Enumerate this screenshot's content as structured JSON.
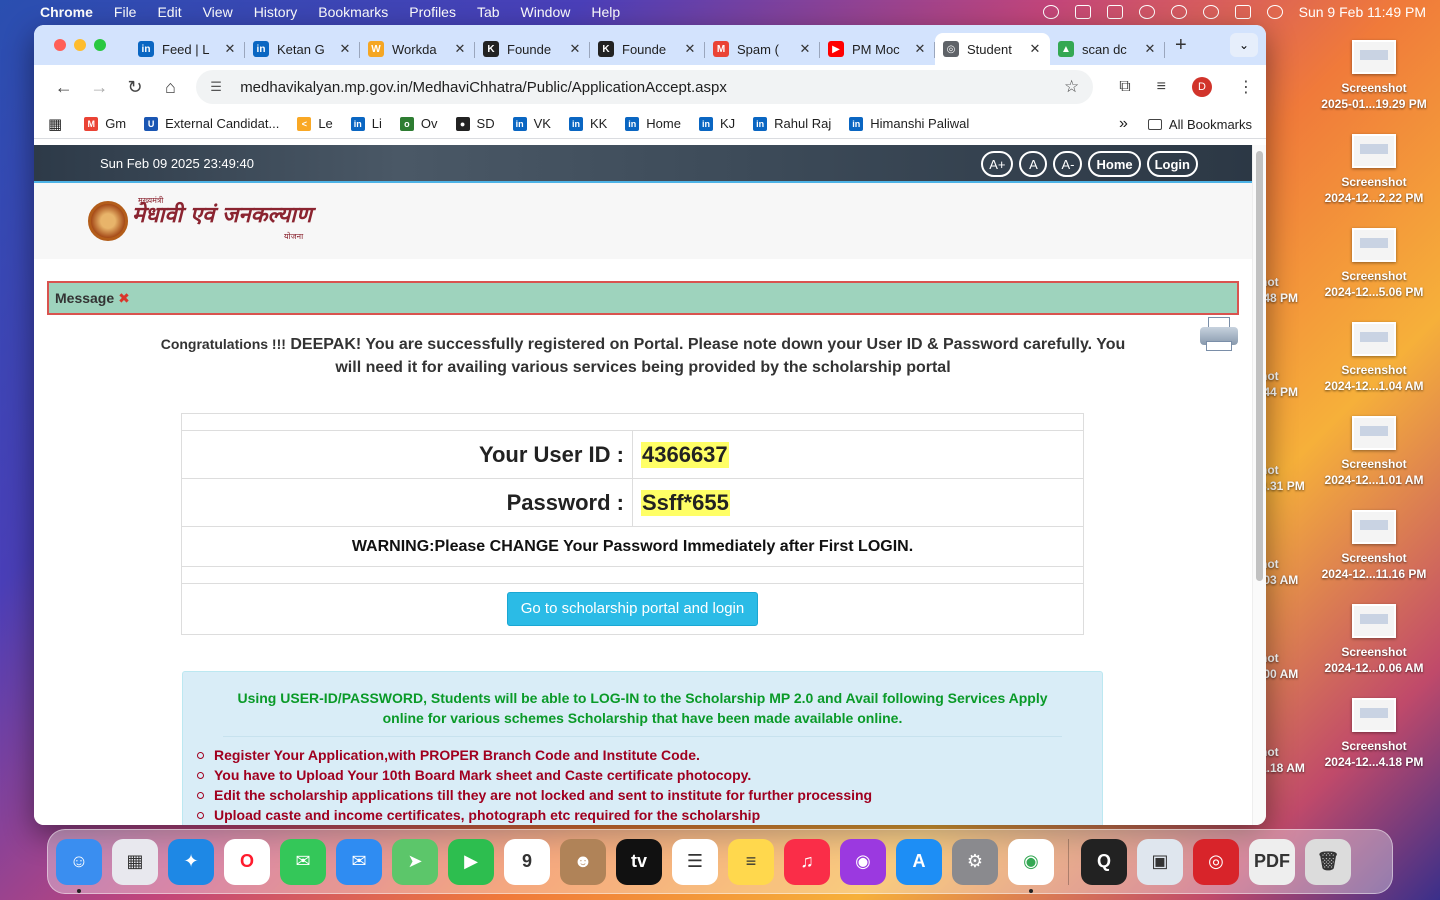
{
  "menubar": {
    "app": "Chrome",
    "items": [
      "File",
      "Edit",
      "View",
      "History",
      "Bookmarks",
      "Profiles",
      "Tab",
      "Window",
      "Help"
    ],
    "datetime": "Sun 9 Feb  11:49 PM"
  },
  "desktop": {
    "icons": [
      {
        "name": "Screenshot",
        "sub": "2025-01...19.29 PM"
      },
      {
        "name": "Screenshot",
        "sub": "2024-12...2.22 PM"
      },
      {
        "name": "Screenshot",
        "sub": "2024-12...5.06 PM"
      },
      {
        "name": "Screenshot",
        "sub": "2024-12...1.04 AM"
      },
      {
        "name": "Screenshot",
        "sub": "2024-12...1.01 AM"
      },
      {
        "name": "Screenshot",
        "sub": "2024-12...11.16 PM"
      },
      {
        "name": "Screenshot",
        "sub": "2024-12...0.06 AM"
      },
      {
        "name": "Screenshot",
        "sub": "2024-12...4.18 PM"
      }
    ],
    "ghosts": [
      "hot",
      ".48 PM",
      "hot",
      ".44 PM",
      "hot",
      "3.31 PM",
      "hot",
      ".03 AM",
      "hot",
      ".00 AM",
      "hot",
      "1.18 AM"
    ]
  },
  "browser": {
    "tabs": [
      {
        "title": "Feed | L",
        "color": "#0a66c2",
        "glyph": "in"
      },
      {
        "title": "Ketan G",
        "color": "#0a66c2",
        "glyph": "in"
      },
      {
        "title": "Workda",
        "color": "#f5a623",
        "glyph": "W"
      },
      {
        "title": "Founde",
        "color": "#222222",
        "glyph": "K"
      },
      {
        "title": "Founde",
        "color": "#222222",
        "glyph": "K"
      },
      {
        "title": "Spam (",
        "color": "#ea4335",
        "glyph": "M"
      },
      {
        "title": "PM Moc",
        "color": "#ff0000",
        "glyph": "▶"
      },
      {
        "title": "Student",
        "color": "#5f6368",
        "glyph": "◎"
      },
      {
        "title": "scan dc",
        "color": "#34a853",
        "glyph": "▲"
      }
    ],
    "url": "medhavikalyan.mp.gov.in/MedhaviChhatra/Public/ApplicationAccept.aspx",
    "profile_initial": "D",
    "bookmarks": [
      {
        "label": "Gm",
        "color": "#ea4335",
        "glyph": "M"
      },
      {
        "label": "External Candidat...",
        "color": "#1a56b3",
        "glyph": "U"
      },
      {
        "label": "Le",
        "color": "#f9a825",
        "glyph": "<"
      },
      {
        "label": "Li",
        "color": "#0a66c2",
        "glyph": "in"
      },
      {
        "label": "Ov",
        "color": "#2e7d32",
        "glyph": "o"
      },
      {
        "label": "SD",
        "color": "#222222",
        "glyph": "●"
      },
      {
        "label": "VK",
        "color": "#0a66c2",
        "glyph": "in"
      },
      {
        "label": "KK",
        "color": "#0a66c2",
        "glyph": "in"
      },
      {
        "label": "Home",
        "color": "#0a66c2",
        "glyph": "in"
      },
      {
        "label": "KJ",
        "color": "#0a66c2",
        "glyph": "in"
      },
      {
        "label": "Rahul Raj",
        "color": "#0a66c2",
        "glyph": "in"
      },
      {
        "label": "Himanshi Paliwal",
        "color": "#0a66c2",
        "glyph": "in"
      }
    ],
    "all_bookmarks": "All Bookmarks"
  },
  "site": {
    "datetime": "Sun Feb 09 2025 23:49:40",
    "font_buttons": [
      "A+",
      "A",
      "A-"
    ],
    "home": "Home",
    "login": "Login",
    "logo_small": "मुख्यमंत्री",
    "logo_text": "मेधावी एवं जनकल्याण",
    "logo_tag": "योजना"
  },
  "message": {
    "label": "Message",
    "congrats_lead": "Congratulations !!!",
    "congrats_body": "DEEPAK! You are successfully registered on Portal. Please note down your User ID & Password carefully. You will need it for availing various services being provided by the scholarship portal"
  },
  "credentials": {
    "user_id_label": "Your User ID :",
    "user_id": "4366637",
    "password_label": "Password :",
    "password": "Ssff*655",
    "warning": "WARNING:Please CHANGE Your Password Immediately after First LOGIN.",
    "button": "Go to scholarship portal and login"
  },
  "info": {
    "heading": "Using USER-ID/PASSWORD, Students will be able to LOG-IN to the Scholarship MP 2.0 and Avail following Services Apply online for various schemes Scholarship that have been made available online.",
    "items": [
      "Register Your Application,with PROPER Branch Code and Institute Code.",
      "You have to Upload Your 10th Board Mark sheet and Caste certificate photocopy.",
      "Edit the scholarship applications till they are not locked and sent to institute for further processing",
      "Upload caste and income certificates, photograph etc required for the scholarship"
    ]
  },
  "dock": {
    "apps": [
      {
        "name": "finder",
        "color": "#3a8ef0",
        "glyph": "☺",
        "dot": true
      },
      {
        "name": "launchpad",
        "color": "#e8e8ee",
        "glyph": "▦",
        "dot": false
      },
      {
        "name": "safari",
        "color": "#1e88e5",
        "glyph": "✦",
        "dot": false
      },
      {
        "name": "opera",
        "color": "#ffffff",
        "glyph": "O",
        "dot": false
      },
      {
        "name": "messages",
        "color": "#34c759",
        "glyph": "✉",
        "dot": false
      },
      {
        "name": "mail",
        "color": "#2f8cf2",
        "glyph": "✉",
        "dot": false
      },
      {
        "name": "maps",
        "color": "#5cc66a",
        "glyph": "➤",
        "dot": false
      },
      {
        "name": "facetime",
        "color": "#2dbe4f",
        "glyph": "▶",
        "dot": false
      },
      {
        "name": "calendar",
        "color": "#ffffff",
        "glyph": "9",
        "dot": false
      },
      {
        "name": "contacts",
        "color": "#b08358",
        "glyph": "☻",
        "dot": false
      },
      {
        "name": "tv",
        "color": "#111111",
        "glyph": "tv",
        "dot": false
      },
      {
        "name": "reminders",
        "color": "#ffffff",
        "glyph": "☰",
        "dot": false
      },
      {
        "name": "notes",
        "color": "#ffd84d",
        "glyph": "≡",
        "dot": false
      },
      {
        "name": "music",
        "color": "#fa2d48",
        "glyph": "♫",
        "dot": false
      },
      {
        "name": "podcasts",
        "color": "#9b39e0",
        "glyph": "◉",
        "dot": false
      },
      {
        "name": "app-store",
        "color": "#1d8ef5",
        "glyph": "A",
        "dot": false
      },
      {
        "name": "system-settings",
        "color": "#8a8a8e",
        "glyph": "⚙",
        "dot": false
      },
      {
        "name": "chrome",
        "color": "#ffffff",
        "glyph": "◉",
        "dot": true
      }
    ],
    "apps_right": [
      {
        "name": "quicktime",
        "color": "#222222",
        "glyph": "Q",
        "dot": false
      },
      {
        "name": "preview",
        "color": "#dfe6ee",
        "glyph": "▣",
        "dot": false
      },
      {
        "name": "photo-booth",
        "color": "#d8242a",
        "glyph": "◎",
        "dot": false
      },
      {
        "name": "downloads-pdf",
        "color": "#eeeeee",
        "glyph": "PDF",
        "dot": false
      },
      {
        "name": "trash",
        "color": "#dcdcdc",
        "glyph": "🗑",
        "dot": false
      }
    ]
  }
}
